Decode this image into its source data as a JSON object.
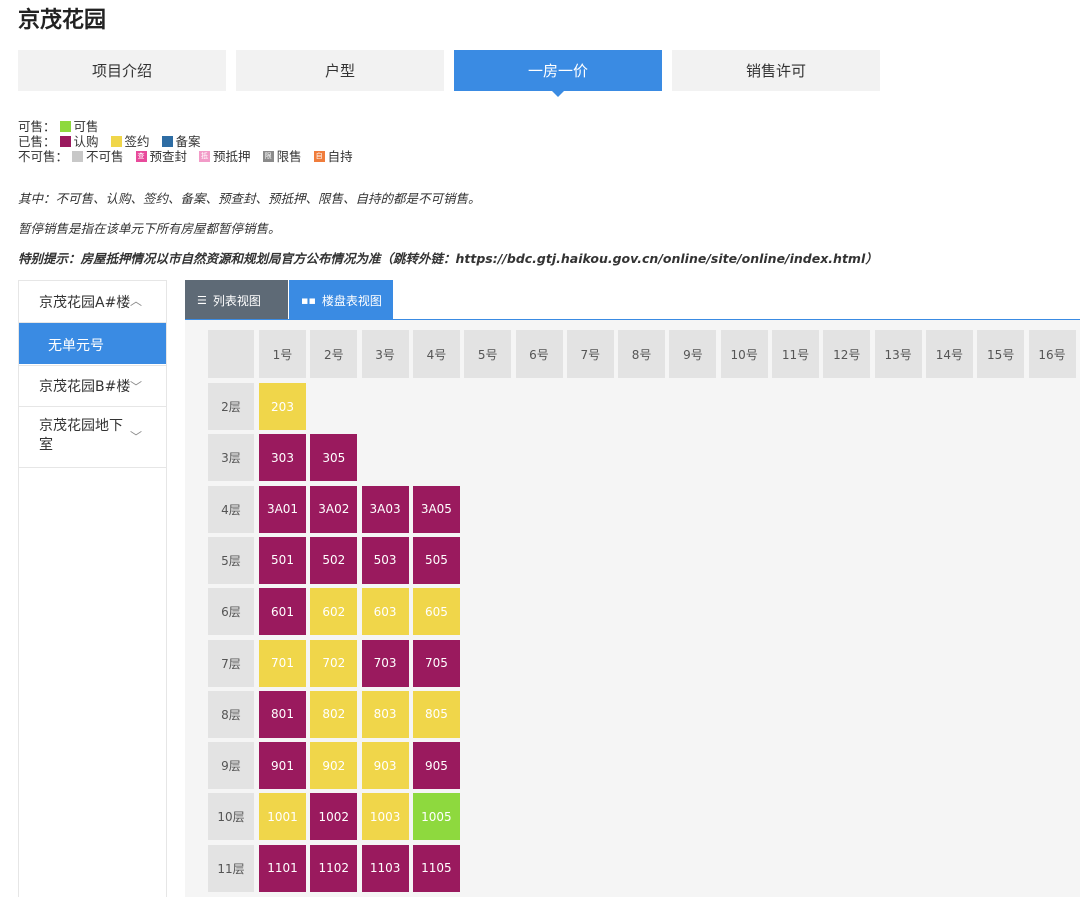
{
  "page_title": "京茂花园",
  "tabs": [
    {
      "label": "项目介绍",
      "active": false
    },
    {
      "label": "户型",
      "active": false
    },
    {
      "label": "一房一价",
      "active": true
    },
    {
      "label": "销售许可",
      "active": false
    }
  ],
  "legend": {
    "for_sale_label": "可售：",
    "for_sale": [
      {
        "label": "可售",
        "color": "#8ed93e",
        "glyph": ""
      }
    ],
    "sold_label": "已售：",
    "sold": [
      {
        "label": "认购",
        "color": "#9a1a5e",
        "glyph": ""
      },
      {
        "label": "签约",
        "color": "#f0d64a",
        "glyph": ""
      },
      {
        "label": "备案",
        "color": "#2e6da4",
        "glyph": ""
      }
    ],
    "not_for_sale_label": "不可售：",
    "not_for_sale": [
      {
        "label": "不可售",
        "color": "#c8c8c8",
        "glyph": ""
      },
      {
        "label": "预查封",
        "color": "#e84a9b",
        "glyph": "查"
      },
      {
        "label": "预抵押",
        "color": "#f29bc8",
        "glyph": "抵"
      },
      {
        "label": "限售",
        "color": "#8a8a8a",
        "glyph": "限"
      },
      {
        "label": "自持",
        "color": "#f07d3c",
        "glyph": "自"
      }
    ]
  },
  "notes": [
    "其中：不可售、认购、签约、备案、预查封、预抵押、限售、自持的都是不可销售。",
    "暂停销售是指在该单元下所有房屋都暂停销售。",
    "特别提示：房屋抵押情况以市自然资源和规划局官方公布情况为准（跳转外链：https://bdc.gtj.haikou.gov.cn/online/site/online/index.html）"
  ],
  "sidebar": {
    "buildings": [
      {
        "label": "京茂花园A#楼",
        "chevron": "︿",
        "expanded": true
      },
      {
        "label": "京茂花园B#楼",
        "chevron": "﹀",
        "expanded": false
      },
      {
        "label": "京茂花园地下室",
        "chevron": "﹀",
        "expanded": false
      }
    ],
    "active_unit": "无单元号"
  },
  "view_tabs": [
    {
      "label": "列表视图",
      "icon": "list-icon",
      "glyph": "☰",
      "active": false
    },
    {
      "label": "楼盘表视图",
      "icon": "grid-icon",
      "glyph": "▪▪",
      "active": true
    }
  ],
  "colors": {
    "认购": "#9a1a5e",
    "签约": "#f0d64a",
    "可售": "#8ed93e",
    "accent": "#3a8be3"
  },
  "grid": {
    "columns": [
      "1号",
      "2号",
      "3号",
      "4号",
      "5号",
      "6号",
      "7号",
      "8号",
      "9号",
      "10号",
      "11号",
      "12号",
      "13号",
      "14号",
      "15号",
      "16号"
    ],
    "floors": [
      {
        "label": "2层",
        "units": [
          {
            "no": "203",
            "status": "签约"
          }
        ]
      },
      {
        "label": "3层",
        "units": [
          {
            "no": "303",
            "status": "认购"
          },
          {
            "no": "305",
            "status": "认购"
          }
        ]
      },
      {
        "label": "4层",
        "units": [
          {
            "no": "3A01",
            "status": "认购"
          },
          {
            "no": "3A02",
            "status": "认购"
          },
          {
            "no": "3A03",
            "status": "认购"
          },
          {
            "no": "3A05",
            "status": "认购"
          }
        ]
      },
      {
        "label": "5层",
        "units": [
          {
            "no": "501",
            "status": "认购"
          },
          {
            "no": "502",
            "status": "认购"
          },
          {
            "no": "503",
            "status": "认购"
          },
          {
            "no": "505",
            "status": "认购"
          }
        ]
      },
      {
        "label": "6层",
        "units": [
          {
            "no": "601",
            "status": "认购"
          },
          {
            "no": "602",
            "status": "签约"
          },
          {
            "no": "603",
            "status": "签约"
          },
          {
            "no": "605",
            "status": "签约"
          }
        ]
      },
      {
        "label": "7层",
        "units": [
          {
            "no": "701",
            "status": "签约"
          },
          {
            "no": "702",
            "status": "签约"
          },
          {
            "no": "703",
            "status": "认购"
          },
          {
            "no": "705",
            "status": "认购"
          }
        ]
      },
      {
        "label": "8层",
        "units": [
          {
            "no": "801",
            "status": "认购"
          },
          {
            "no": "802",
            "status": "签约"
          },
          {
            "no": "803",
            "status": "签约"
          },
          {
            "no": "805",
            "status": "签约"
          }
        ]
      },
      {
        "label": "9层",
        "units": [
          {
            "no": "901",
            "status": "认购"
          },
          {
            "no": "902",
            "status": "签约"
          },
          {
            "no": "903",
            "status": "签约"
          },
          {
            "no": "905",
            "status": "认购"
          }
        ]
      },
      {
        "label": "10层",
        "units": [
          {
            "no": "1001",
            "status": "签约"
          },
          {
            "no": "1002",
            "status": "认购"
          },
          {
            "no": "1003",
            "status": "签约"
          },
          {
            "no": "1005",
            "status": "可售"
          }
        ]
      },
      {
        "label": "11层",
        "units": [
          {
            "no": "1101",
            "status": "认购"
          },
          {
            "no": "1102",
            "status": "认购"
          },
          {
            "no": "1103",
            "status": "认购"
          },
          {
            "no": "1105",
            "status": "认购"
          }
        ]
      }
    ]
  }
}
